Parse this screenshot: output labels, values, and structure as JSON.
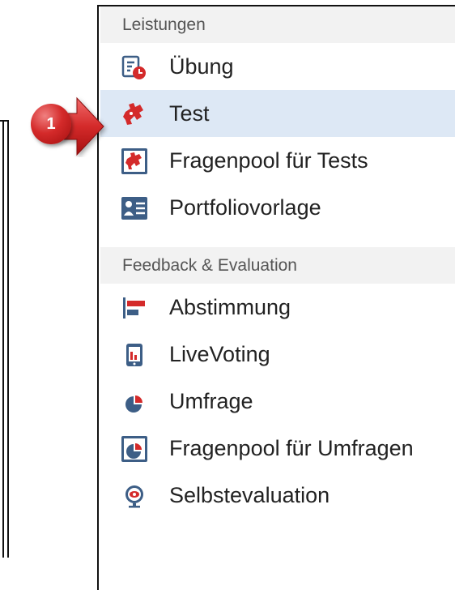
{
  "sections": [
    {
      "header": "Leistungen",
      "items": [
        {
          "label": "Übung",
          "icon": "exercise-icon",
          "active": false
        },
        {
          "label": "Test",
          "icon": "puzzle-piece-icon",
          "active": true
        },
        {
          "label": "Fragenpool für Tests",
          "icon": "test-question-pool-icon",
          "active": false
        },
        {
          "label": "Portfoliovorlage",
          "icon": "portfolio-template-icon",
          "active": false
        }
      ]
    },
    {
      "header": "Feedback & Evaluation",
      "items": [
        {
          "label": "Abstimmung",
          "icon": "poll-icon",
          "active": false
        },
        {
          "label": "LiveVoting",
          "icon": "live-voting-icon",
          "active": false
        },
        {
          "label": "Umfrage",
          "icon": "survey-icon",
          "active": false
        },
        {
          "label": "Fragenpool für Umfragen",
          "icon": "survey-question-pool-icon",
          "active": false
        },
        {
          "label": "Selbstevaluation",
          "icon": "self-evaluation-icon",
          "active": false
        }
      ]
    }
  ],
  "callout": {
    "number": "1"
  },
  "colors": {
    "accent_red": "#d42a2a",
    "active_bg": "#dde8f5",
    "icon_blue": "#3d5e86",
    "header_bg": "#f2f2f2"
  }
}
